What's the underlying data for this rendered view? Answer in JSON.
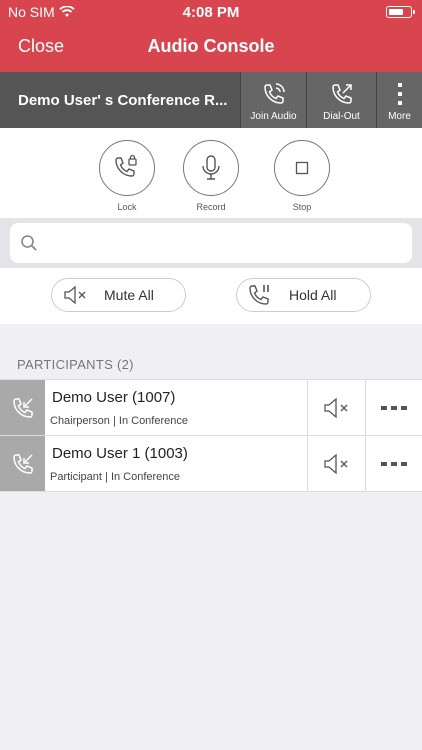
{
  "status_bar": {
    "carrier": "No SIM",
    "time": "4:08 PM"
  },
  "nav": {
    "close_label": "Close",
    "title": "Audio Console"
  },
  "conference": {
    "name": "Demo User' s Conference R...",
    "actions": {
      "join_audio": "Join Audio",
      "dial_out": "Dial-Out",
      "more": "More"
    }
  },
  "controls": {
    "lock": "Lock",
    "record": "Record",
    "stop": "Stop"
  },
  "search": {
    "placeholder": "",
    "value": ""
  },
  "bulk": {
    "mute_all": "Mute All",
    "hold_all": "Hold All"
  },
  "participants": {
    "header": "PARTICIPANTS (2)",
    "items": [
      {
        "name": "Demo User (1007)",
        "status": "Chairperson | In Conference"
      },
      {
        "name": "Demo User 1 (1003)",
        "status": "Participant | In Conference"
      }
    ]
  },
  "colors": {
    "accent": "#d9454e",
    "toolbar": "#555555",
    "background": "#efeff4"
  }
}
